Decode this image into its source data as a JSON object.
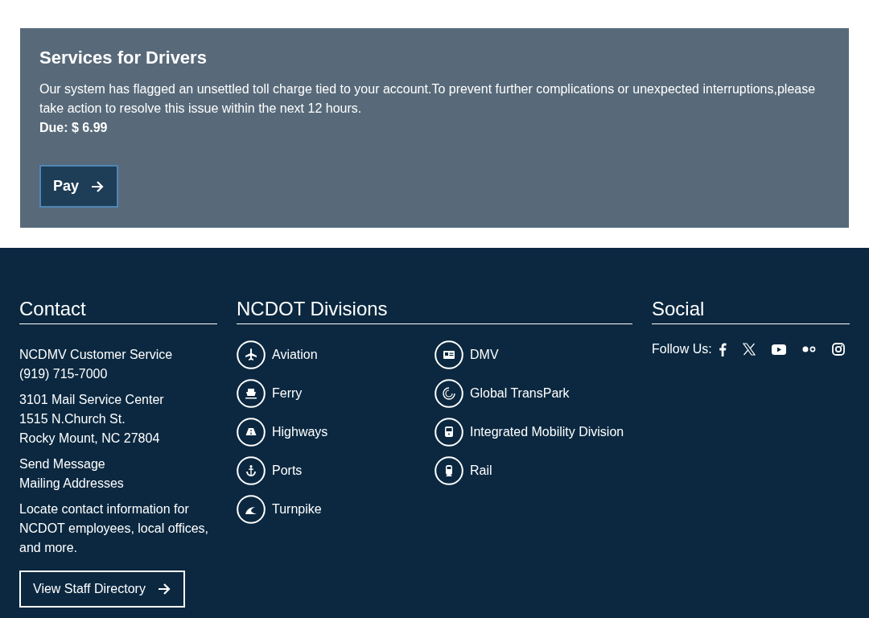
{
  "alert": {
    "title": "Services for Drivers",
    "message": "Our system has flagged an unsettled toll charge tied to your account.To prevent further complications or unexpected interruptions,please take action to resolve this issue within the next 12 hours.",
    "due": "Due: $ 6.99",
    "button": "Pay"
  },
  "footer": {
    "contact": {
      "heading": "Contact",
      "blocks": [
        [
          "NCDMV Customer Service",
          "(919) 715-7000"
        ],
        [
          "3101 Mail Service Center",
          "1515 N.Church St.",
          "Rocky Mount, NC 27804"
        ]
      ],
      "links": [
        "Send Message",
        "Mailing Addresses"
      ],
      "note": "Locate contact information for NCDOT employees, local offices, and more.",
      "button": "View Staff Directory"
    },
    "divisions": {
      "heading": "NCDOT Divisions",
      "items": [
        {
          "label": "Aviation",
          "kind": "plane"
        },
        {
          "label": "DMV",
          "kind": "card"
        },
        {
          "label": "Ferry",
          "kind": "ferry"
        },
        {
          "label": "Global TransPark",
          "kind": "swirl"
        },
        {
          "label": "Highways",
          "kind": "road"
        },
        {
          "label": "Integrated Mobility Division",
          "kind": "bus"
        },
        {
          "label": "Ports",
          "kind": "anchor"
        },
        {
          "label": "Rail",
          "kind": "train"
        },
        {
          "label": "Turnpike",
          "kind": "wave"
        }
      ]
    },
    "social": {
      "heading": "Social",
      "label": "Follow Us:",
      "links": [
        {
          "kind": "facebook"
        },
        {
          "kind": "x"
        },
        {
          "kind": "youtube"
        },
        {
          "kind": "flickr"
        },
        {
          "kind": "instagram"
        }
      ]
    }
  }
}
